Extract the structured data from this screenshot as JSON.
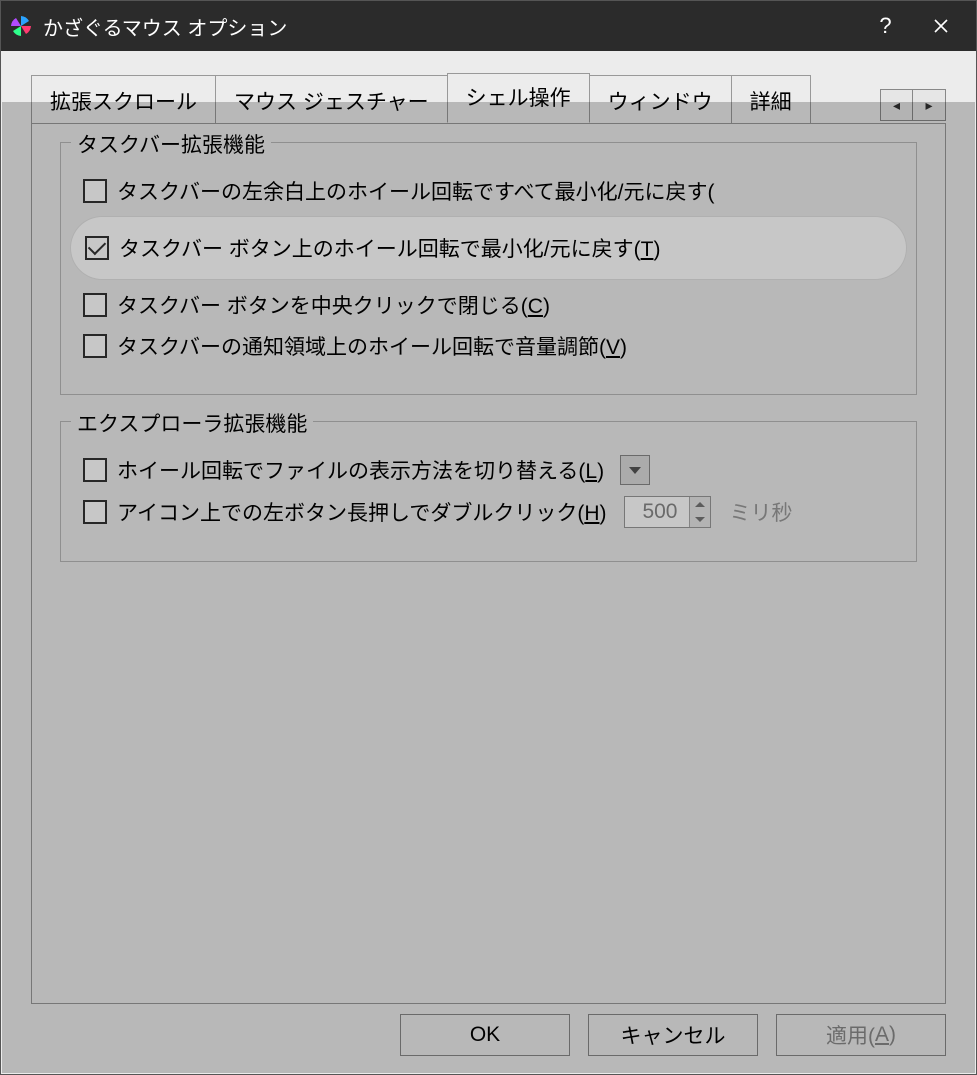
{
  "window": {
    "title": "かざぐるマウス オプション"
  },
  "tabs": {
    "extended_scroll": "拡張スクロール",
    "mouse_gesture": "マウス ジェスチャー",
    "shell": "シェル操作",
    "window": "ウィンドウ",
    "detail": "詳細"
  },
  "group1": {
    "legend": "タスクバー拡張機能",
    "opt1": "タスクバーの左余白上のホイール回転ですべて最小化/元に戻す(",
    "opt2_a": "タスクバー ボタン上のホイール回転で最小化/元に戻す(",
    "opt2_key": "T",
    "opt2_b": ")",
    "opt3_a": "タスクバー ボタンを中央クリックで閉じる(",
    "opt3_key": "C",
    "opt3_b": ")",
    "opt4_a": "タスクバーの通知領域上のホイール回転で音量調節(",
    "opt4_key": "V",
    "opt4_b": ")"
  },
  "group2": {
    "legend": "エクスプローラ拡張機能",
    "opt1_a": "ホイール回転でファイルの表示方法を切り替える(",
    "opt1_key": "L",
    "opt1_b": ")",
    "opt2_a": "アイコン上での左ボタン長押しでダブルクリック(",
    "opt2_key": "H",
    "opt2_b": ")",
    "delay_value": "500",
    "delay_unit": "ミリ秒"
  },
  "buttons": {
    "ok": "OK",
    "cancel": "キャンセル",
    "apply_a": "適用(",
    "apply_key": "A",
    "apply_b": ")"
  }
}
